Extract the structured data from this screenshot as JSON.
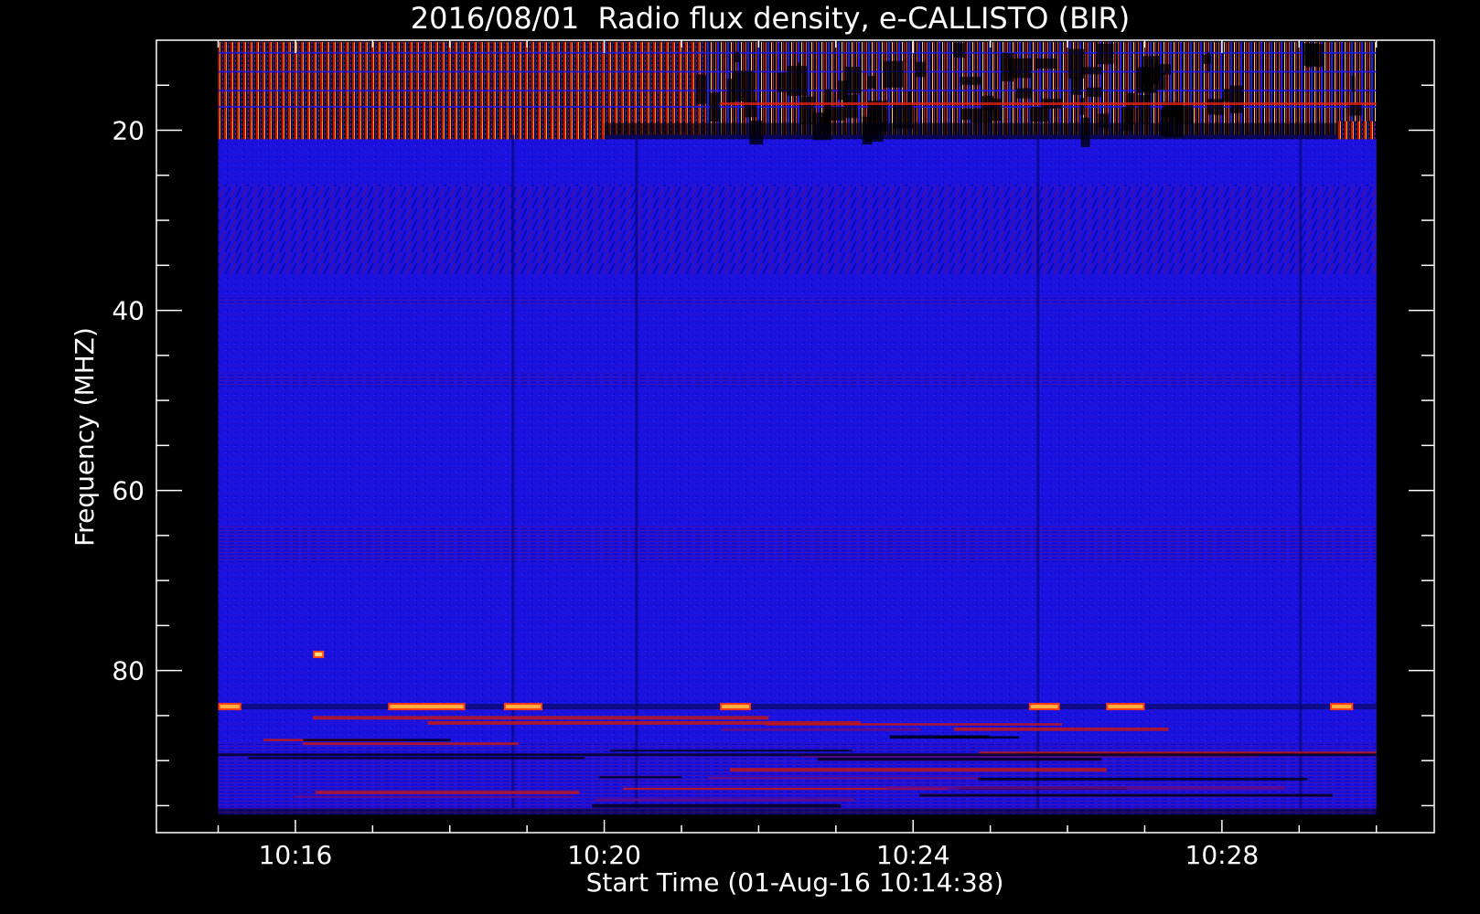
{
  "chart_data": {
    "type": "heatmap",
    "title": "2016/08/01  Radio flux density, e-CALLISTO (BIR)",
    "xlabel": "Start Time (01-Aug-16 10:14:38)",
    "ylabel": "Frequency (MHZ)",
    "x_ticks": [
      "10:16",
      "10:20",
      "10:24",
      "10:28"
    ],
    "x_tick_values_min": [
      16,
      20,
      24,
      28
    ],
    "x_minor_step_min": 1,
    "x_range_min": [
      14.2,
      30.75
    ],
    "y_ticks": [
      "20",
      "40",
      "60",
      "80"
    ],
    "y_tick_values": [
      20,
      40,
      60,
      80
    ],
    "y_minor_step": 5,
    "y_range_mhz": [
      10,
      98
    ],
    "y_inverted": true,
    "data_extent": {
      "time_min": [
        15.0,
        30.0
      ],
      "freq_mhz": [
        10.2,
        95.3
      ]
    },
    "colormap": [
      "#000000",
      "#0000ff",
      "#ff0000",
      "#ffff80"
    ],
    "background_color": "#1a12e0",
    "features": [
      {
        "type": "rfi-band",
        "freq_mhz": [
          10.2,
          20.5
        ],
        "time_min": [
          15.0,
          30.0
        ],
        "intensity": "high"
      },
      {
        "type": "hot-band",
        "freq_mhz": [
          19.0,
          21.0
        ],
        "time_min": [
          15.0,
          20.0
        ],
        "intensity": "very-high"
      },
      {
        "type": "emission-line",
        "freq_mhz": 84.0,
        "time_min": [
          15.0,
          30.0
        ],
        "intensity": "high"
      },
      {
        "type": "noise-band",
        "freq_mhz": [
          85.0,
          95.3
        ],
        "time_min": [
          15.0,
          30.0
        ],
        "intensity": "medium"
      },
      {
        "type": "burst-dot",
        "freq_mhz": 78.2,
        "time_min": 16.3
      }
    ]
  }
}
